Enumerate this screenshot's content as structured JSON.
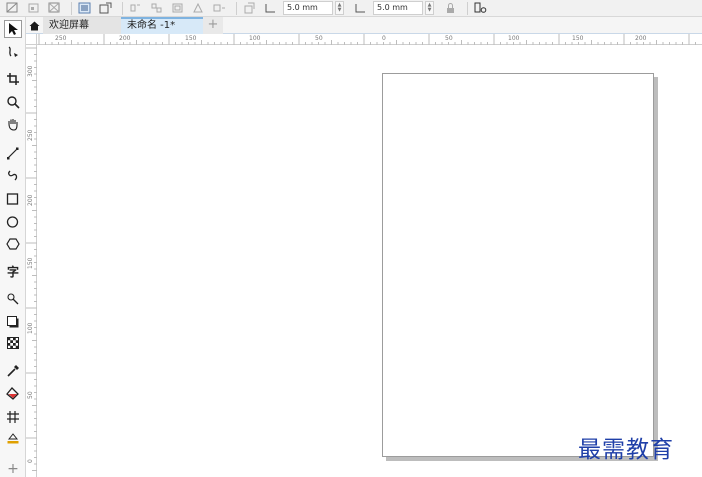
{
  "propbar": {
    "nudge_x_value": "5.0 mm",
    "nudge_y_value": "5.0 mm"
  },
  "tabs": [
    {
      "label": "欢迎屏幕"
    },
    {
      "label": "未命名 -1*"
    },
    {
      "label": "+"
    }
  ],
  "toolbox": {
    "text_tool_glyph": "字",
    "add_tool_glyph": "+"
  },
  "ruler": {
    "h_labels": [
      "250",
      "200",
      "150",
      "100",
      "50",
      "0",
      "50",
      "100",
      "150",
      "200"
    ],
    "v_labels": [
      "300",
      "250",
      "200",
      "150",
      "100",
      "50",
      "0"
    ]
  },
  "watermark": {
    "text": "最需教育"
  }
}
